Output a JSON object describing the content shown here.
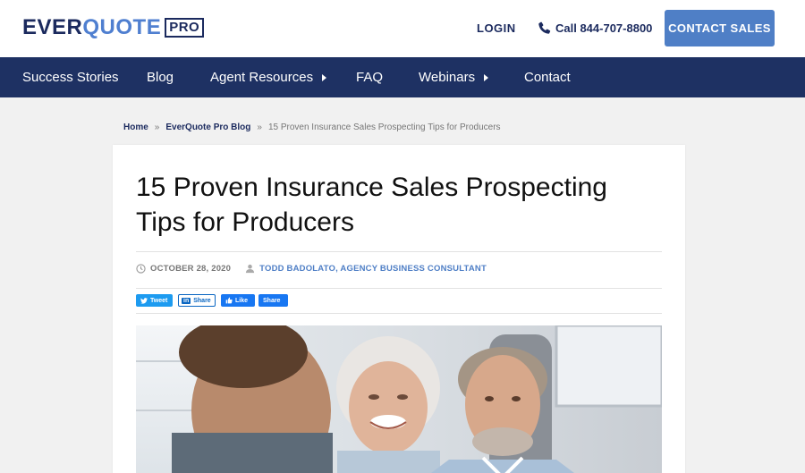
{
  "header": {
    "logo": {
      "part1": "EVER",
      "part2": "QUOTE",
      "badge": "PRO"
    },
    "login_label": "LOGIN",
    "phone_label": "Call 844-707-8800",
    "contact_label": "CONTACT SALES"
  },
  "nav": {
    "items": [
      {
        "label": "Success Stories"
      },
      {
        "label": "Blog"
      },
      {
        "label": "Agent Resources"
      },
      {
        "label": "FAQ"
      },
      {
        "label": "Webinars"
      },
      {
        "label": "Contact"
      }
    ]
  },
  "breadcrumb": {
    "home": "Home",
    "sep": "»",
    "blog": "EverQuote Pro Blog",
    "current": "15 Proven Insurance Sales Prospecting Tips for Producers"
  },
  "article": {
    "title": "15 Proven Insurance Sales Prospecting Tips for Producers",
    "date": "OCTOBER 28, 2020",
    "author": "TODD BADOLATO, AGENCY BUSINESS CONSULTANT"
  },
  "share": {
    "tweet": "Tweet",
    "linkedin_badge": "in",
    "linkedin": "Share",
    "fb_like": "Like",
    "fb_share": "Share"
  },
  "colors": {
    "nav_bg": "#1e3163",
    "brand_dark": "#1b2a5e",
    "brand_accent": "#4f7fc6"
  }
}
